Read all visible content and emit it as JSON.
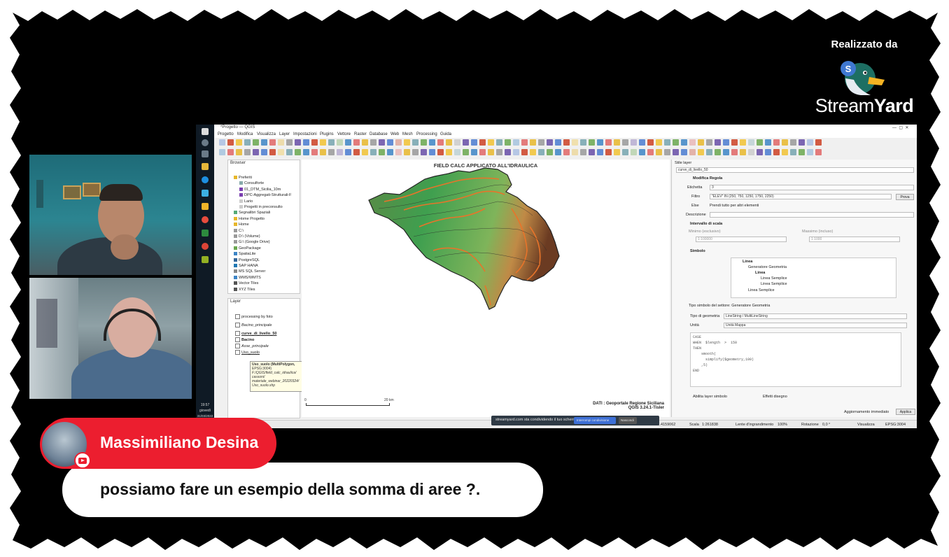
{
  "branding": {
    "top_text": "Realizzato da",
    "name_light": "Stream",
    "name_bold": "Yard"
  },
  "qgis": {
    "window_title": "*Progetto — QGIS",
    "menu": [
      "Progetto",
      "Modifica",
      "Visualizza",
      "Layer",
      "Impostazioni",
      "Plugins",
      "Vettore",
      "Raster",
      "Database",
      "Web",
      "Mesh",
      "Processing",
      "Guida"
    ],
    "browser": {
      "title": "Browser",
      "items": [
        "Preferiti",
        "Consulforte",
        "01_DTM_Sicilia_10m",
        "DPC-Aggregati-Strutturali-F",
        "Lario",
        "Progetti in preconsulto",
        "Segnalibri Spaziali",
        "Home Progetto",
        "Home",
        "C:\\",
        "D:\\ (Volume)",
        "G:\\ (Google Drive)",
        "GeoPackage",
        "SpatiaLite",
        "PostgreSQL",
        "SAP HANA",
        "MS SQL Server",
        "WMS/WMTS",
        "Vector Tiles",
        "XYZ Tiles"
      ]
    },
    "layers": {
      "title": "Layer",
      "items": [
        "processing by foto",
        "Bacino_principale",
        "curve_di_livello_50",
        "Bacino",
        "Asse_principale",
        "Uso_suolo"
      ]
    },
    "tooltip": [
      "Uso_suolo (MultiPolygon,",
      "EPSG:3004)",
      "F:/QGIS/field_calc_idraulica/",
      "cassoni/",
      "materiale_webinar_20220324/",
      "Uso_suolo.shp"
    ],
    "map": {
      "title": "FIELD CALC APPLICATO ALL'IDRAULICA",
      "credit_line1": "DATI : Geoportale Regione Siciliana",
      "credit_line2": "QGIS 3.24.1-Tisler",
      "scale_left": "0",
      "scale_right": "20 km"
    },
    "style_panel": {
      "title": "Stile layer",
      "layer_name": "curve_di_livello_50",
      "rule_heading": "Modifica Regola",
      "label_etichetta": "Etichetta",
      "etichetta_value": "3",
      "label_filtro": "Filtro",
      "filtro_value": "\"ELEV\" IN (250, 750, 1250, 1750, 2250)",
      "button_prova": "Prova",
      "label_else": "Else",
      "else_value": "Prendi tutto per altri elementi",
      "label_descrizione": "Descrizione",
      "scale_heading": "Intervallo di scala",
      "min_label": "Minimo (esclusivo)",
      "min_value": "1:100000",
      "max_label": "Massimo (incluso)",
      "max_value": "1:1000",
      "symbol_heading": "Simbolo",
      "symbol_tree": [
        "Linea",
        "Generatore Geometria",
        "Linea",
        "Linea Semplice",
        "Linea Semplice",
        "Linea Semplice"
      ],
      "symbol_type_label": "Tipo simbolo del settore: Generatore Geometria",
      "geom_type_label": "Tipo di geometria",
      "geom_type_value": "LineString / MultiLineString",
      "units_label": "Unità",
      "units_value": "Unità Mappa",
      "code_lines": [
        "CASE",
        "WHEN  $length  >  150",
        "THEN",
        "    smooth(",
        "      simplify($geometry,100)",
        "    ,5)",
        "END"
      ],
      "enable_layer": "Abilita layer simbolo",
      "draw_effects": "Effetti disegno",
      "live_update": "Aggiornamento immediato",
      "apply": "Applica"
    },
    "status": {
      "coords": "2456092.4159062",
      "scale_label": "Scala",
      "scale_value": "1:261838",
      "magnifier_label": "Lente d'ingrandimento",
      "magnifier_value": "100%",
      "rotation_label": "Rotazione",
      "rotation_value": "0,0 °",
      "render": "Visualizza",
      "crs": "EPSG:3004"
    },
    "notification": {
      "text": "streamyard.com sta condividendo il tuo schermo.",
      "primary": "Interrompi condivisione",
      "secondary": "Nascondi"
    },
    "clock": {
      "time": "19:57",
      "day": "giovedì",
      "date": "31/03/2022"
    }
  },
  "comment": {
    "author": "Massimiliano Desina",
    "text": "possiamo fare un esempio della somma di aree ?."
  },
  "colors": {
    "banner_red": "#ec1e2f",
    "frame": "#000000",
    "map_green": "#3a9b4b",
    "contour_orange": "#e8742a"
  }
}
